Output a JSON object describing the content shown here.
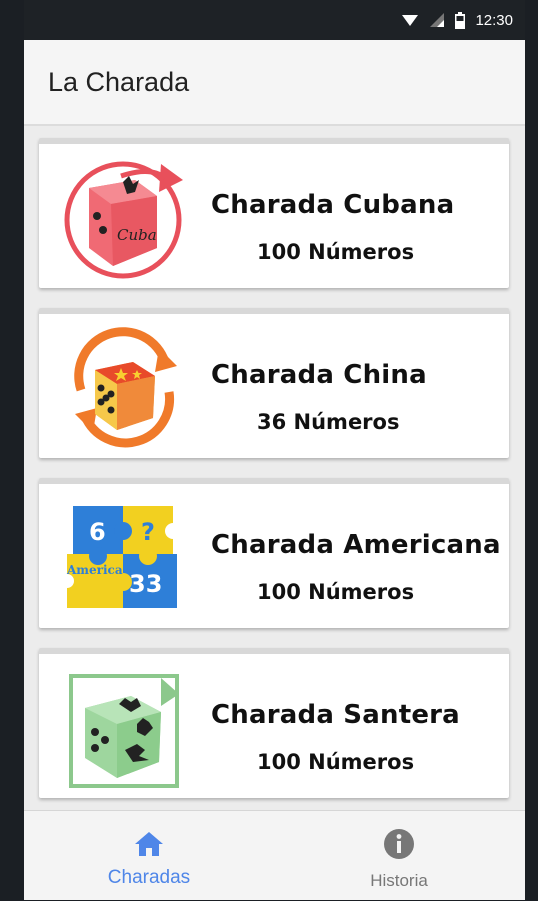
{
  "status_bar": {
    "time": "12:30"
  },
  "app_bar": {
    "title": "La Charada"
  },
  "charadas": [
    {
      "name": "Charada Cubana",
      "count": "100 Números",
      "logo": "cuba-dice-icon",
      "logo_text": "Cuba"
    },
    {
      "name": "Charada China",
      "count": "36 Números",
      "logo": "china-dice-icon"
    },
    {
      "name": "Charada Americana",
      "count": "100 Números",
      "logo": "america-puzzle-icon",
      "logo_text": [
        "6",
        "?",
        "America",
        "33"
      ]
    },
    {
      "name": "Charada Santera",
      "count": "100 Números",
      "logo": "santera-dice-icon"
    }
  ],
  "bottom_nav": {
    "items": [
      {
        "label": "Charadas",
        "icon": "home-icon",
        "active": true
      },
      {
        "label": "Historia",
        "icon": "info-icon",
        "active": false
      }
    ]
  },
  "colors": {
    "accent": "#4f86e8",
    "inactive": "#777777"
  }
}
